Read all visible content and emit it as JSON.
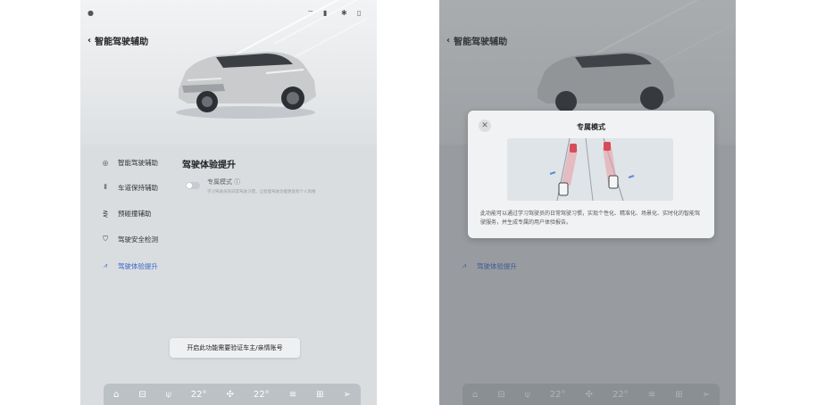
{
  "screen_left": {
    "back_title": "智能驾驶辅助",
    "status_icons": [
      "wifi-icon",
      "signal-icon",
      "bluetooth-icon",
      "battery-icon"
    ],
    "sidebar": [
      {
        "label": "智能驾驶辅助",
        "icon": "steering-icon"
      },
      {
        "label": "车道保持辅助",
        "icon": "lane-icon"
      },
      {
        "label": "预碰撞辅助",
        "icon": "collision-icon"
      },
      {
        "label": "驾驶安全检测",
        "icon": "shield-icon"
      },
      {
        "label": "驾驶体验提升",
        "icon": "road-icon",
        "active": true
      }
    ],
    "section_title": "驾驶体验提升",
    "option": {
      "title": "专属模式 ⓘ",
      "description": "学习驾驶员的日常驾驶习惯，让智能驾驶功能更具有个人风格",
      "enabled": false
    },
    "notice_button": "开启此功能需要验证车主/亲情账号",
    "dock": {
      "left_temp": "22°",
      "right_temp": "22°",
      "icons": [
        "home-icon",
        "car-icon",
        "defrost-icon",
        "fan-icon",
        "seat-heat-icon",
        "apps-icon",
        "navigation-icon"
      ]
    }
  },
  "screen_right": {
    "back_title": "智能驾驶辅助",
    "sidebar_visible_label": "驾驶体验提升",
    "modal": {
      "title": "专属模式",
      "description": "此功能可以通过学习驾驶员的日常驾驶习惯，实现个性化、精准化、场景化、实时化的智能驾驶服务，并生成专属的用户体验报告。"
    },
    "dock": {
      "left_temp": "22°",
      "right_temp": "22°"
    }
  },
  "colors": {
    "accent": "#3b66c8",
    "panel_bg": "#d9dde0",
    "overlay": "#464a4e"
  }
}
